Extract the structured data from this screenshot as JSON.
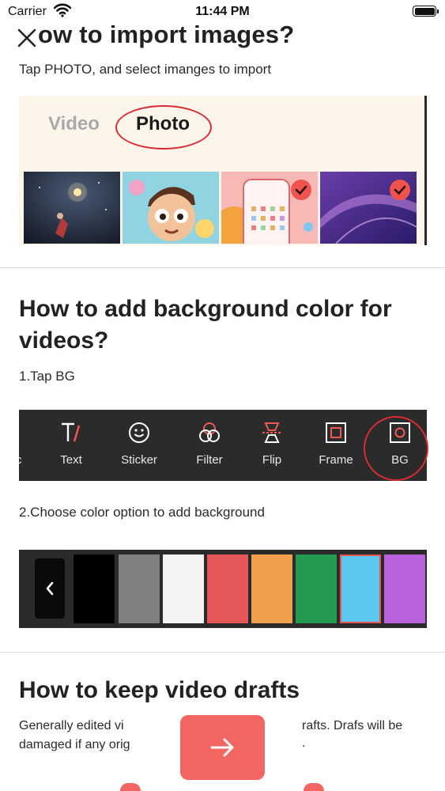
{
  "status_bar": {
    "carrier": "Carrier",
    "time": "11:44 PM"
  },
  "section_import": {
    "title_visible": "ow to import images?",
    "subtitle": "Tap PHOTO, and select imanges to import",
    "tabs": {
      "video": "Video",
      "photo": "Photo"
    }
  },
  "section_bg": {
    "title_line1": "How to add background color for",
    "title_line2": "videos?",
    "step1": "1.Tap BG",
    "tools": [
      {
        "label": "Text",
        "icon": "text-icon"
      },
      {
        "label": "Sticker",
        "icon": "smiley-icon"
      },
      {
        "label": "Filter",
        "icon": "filter-icon"
      },
      {
        "label": "Flip",
        "icon": "flip-icon"
      },
      {
        "label": "Frame",
        "icon": "frame-icon"
      },
      {
        "label": "BG",
        "icon": "bg-icon"
      }
    ],
    "step2": "2.Choose color option to add background",
    "swatches": [
      "#000000",
      "#808080",
      "#f4f4f4",
      "#e55656",
      "#f0a04b",
      "#239a4f",
      "#5cc8f0",
      "#b862db"
    ],
    "accent": "#d82c35"
  },
  "section_drafts": {
    "title": "How to keep video drafts",
    "line1_left": "Generally edited vi",
    "line1_right": "rafts. Drafs will be",
    "line2_left": "damaged if any orig",
    "line2_right": "."
  },
  "next_button": {
    "color": "#f26560",
    "icon": "arrow-right-icon"
  }
}
